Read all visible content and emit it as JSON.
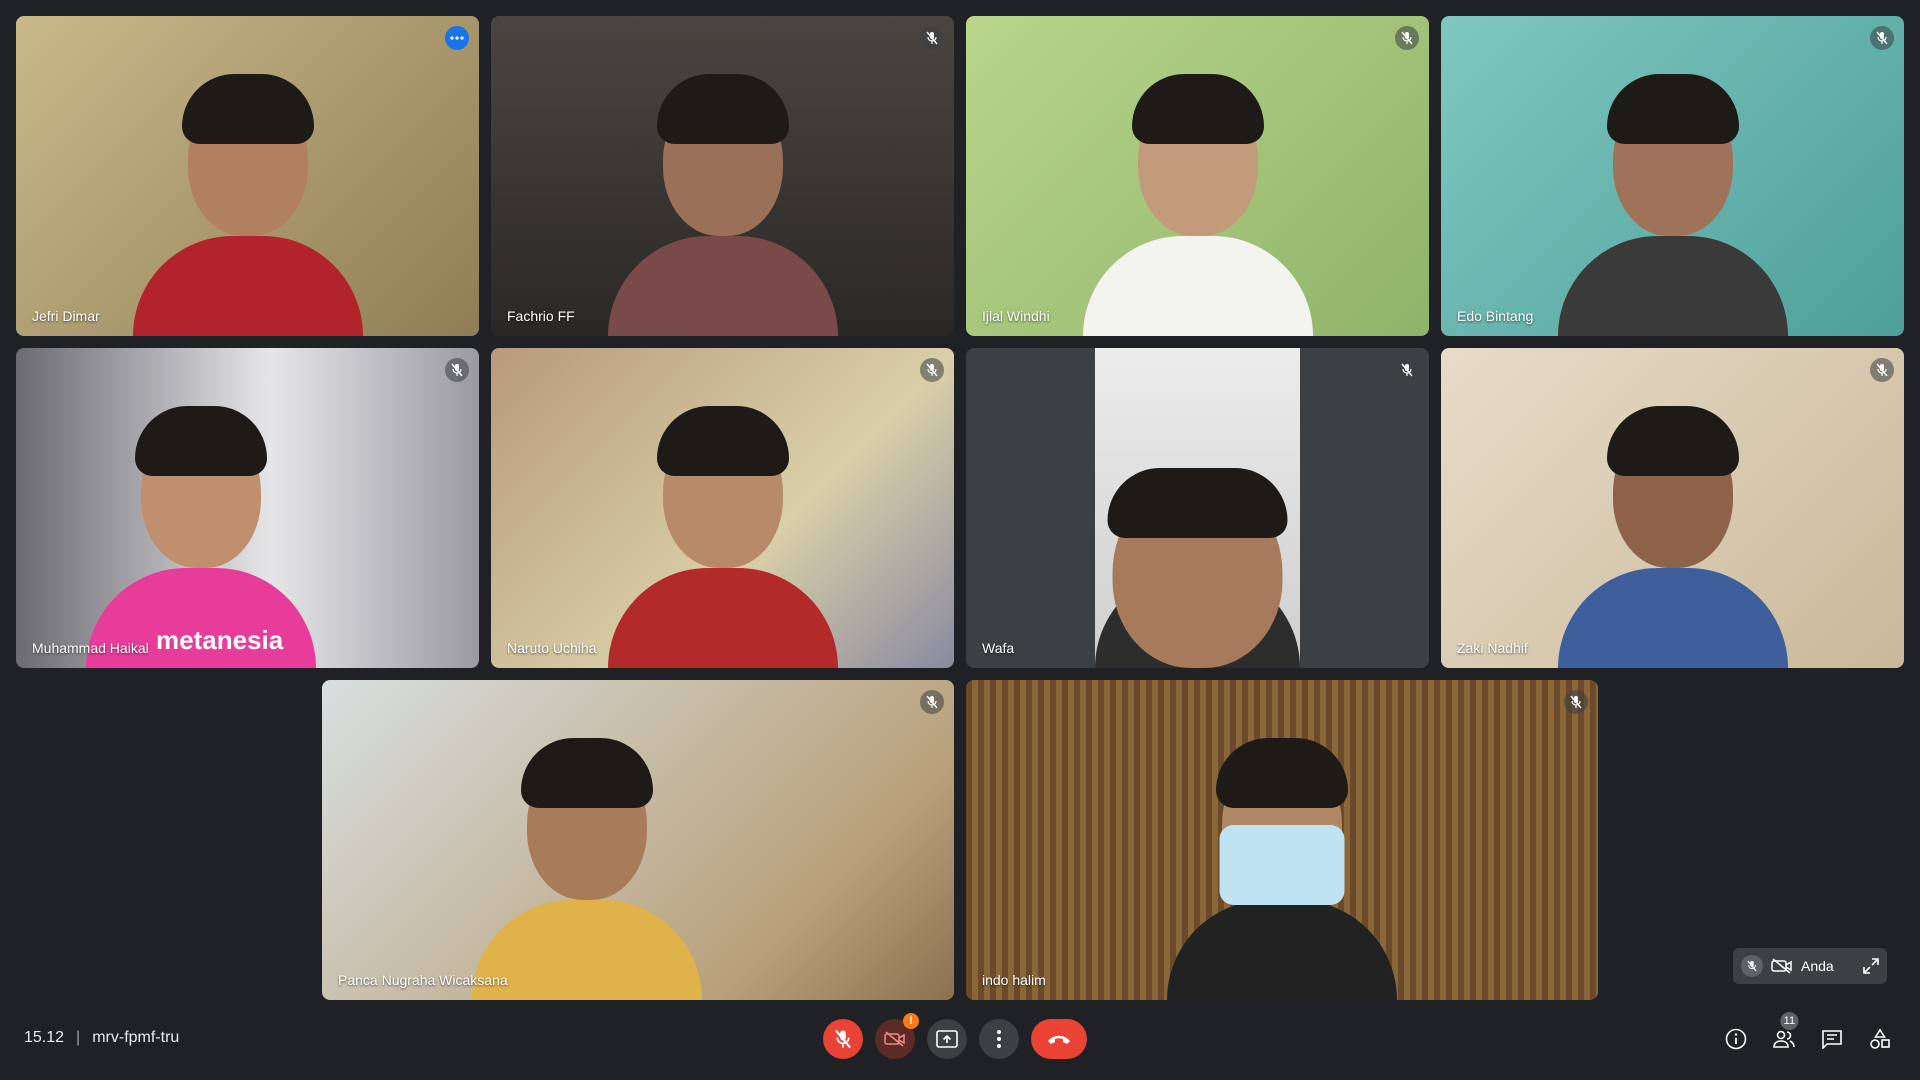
{
  "participants": [
    {
      "name": "Jefri Dimar",
      "muted": false,
      "active": true
    },
    {
      "name": "Fachrio FF",
      "muted": true
    },
    {
      "name": "Ijlal Windhi",
      "muted": true
    },
    {
      "name": "Edo Bintang",
      "muted": true
    },
    {
      "name": "Muhammad Haikal",
      "muted": true
    },
    {
      "name": "Naruto Uchiha",
      "muted": true
    },
    {
      "name": "Wafa",
      "muted": true
    },
    {
      "name": "Zaki Nadhif",
      "muted": true
    },
    {
      "name": "Panca Nugraha Wicaksana",
      "muted": true
    },
    {
      "name": "indo halim",
      "muted": true
    }
  ],
  "shirt_text": "metanesia",
  "self_view": {
    "label": "Anda"
  },
  "bottom_bar": {
    "time": "15.12",
    "separator": "|",
    "meeting_code": "mrv-fpmf-tru",
    "people_count": "11",
    "camera_warning": "!"
  },
  "colors": {
    "background": "#202124",
    "end_call": "#ea4335",
    "active_outline": "#8ab4f8",
    "more_button": "#1a73e8"
  }
}
